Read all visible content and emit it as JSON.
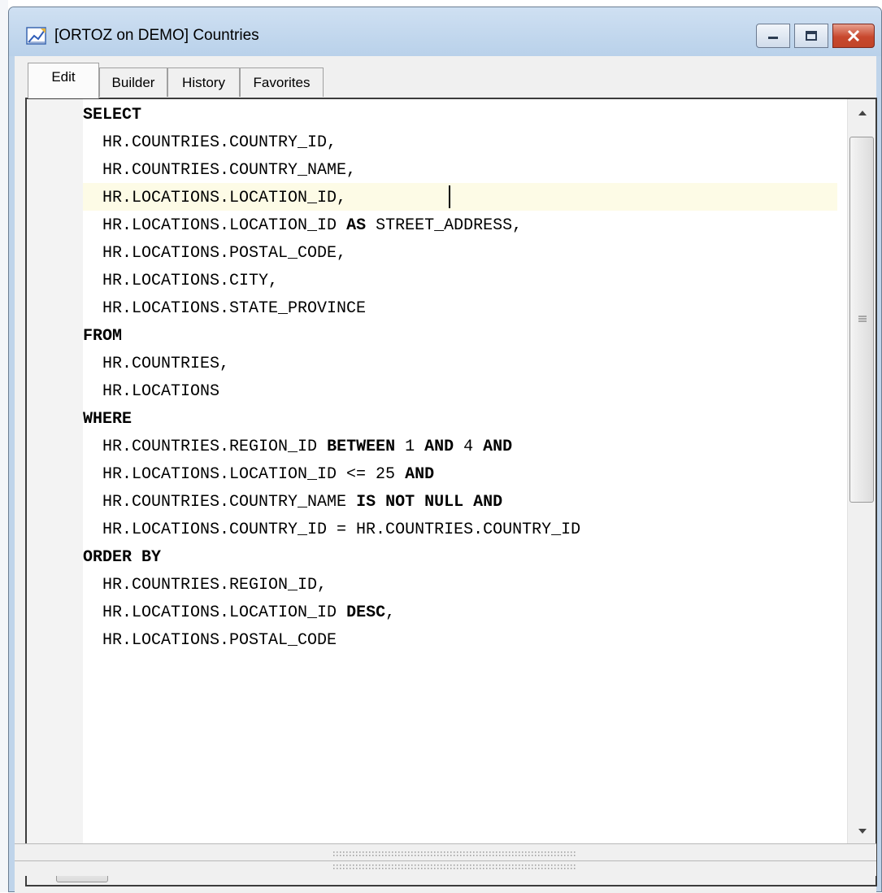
{
  "window": {
    "title": "[ORTOZ on DEMO] Countries",
    "controls": [
      "minimize-icon",
      "maximize-icon",
      "close-icon"
    ]
  },
  "tabs": [
    {
      "label": "Edit",
      "active": true
    },
    {
      "label": "Builder",
      "active": false
    },
    {
      "label": "History",
      "active": false
    },
    {
      "label": "Favorites",
      "active": false
    }
  ],
  "editor": {
    "current_line": 3,
    "lines": [
      "SELECT",
      "  HR.COUNTRIES.COUNTRY_ID,",
      "  HR.COUNTRIES.COUNTRY_NAME,",
      "  HR.LOCATIONS.LOCATION_ID,",
      "  HR.LOCATIONS.LOCATION_ID AS STREET_ADDRESS,",
      "  HR.LOCATIONS.POSTAL_CODE,",
      "  HR.LOCATIONS.CITY,",
      "  HR.LOCATIONS.STATE_PROVINCE",
      "FROM",
      "  HR.COUNTRIES,",
      "  HR.LOCATIONS",
      "WHERE",
      "  HR.COUNTRIES.REGION_ID BETWEEN 1 AND 4 AND",
      "  HR.LOCATIONS.LOCATION_ID <= 25 AND",
      "  HR.COUNTRIES.COUNTRY_NAME IS NOT NULL AND",
      "  HR.LOCATIONS.COUNTRY_ID = HR.COUNTRIES.COUNTRY_ID",
      "ORDER BY",
      "  HR.COUNTRIES.REGION_ID,",
      "  HR.LOCATIONS.LOCATION_ID DESC,",
      "  HR.LOCATIONS.POSTAL_CODE"
    ],
    "keywords": [
      "SELECT",
      "FROM",
      "WHERE",
      "ORDER BY",
      "AS",
      "BETWEEN",
      "AND",
      "IS",
      "NOT",
      "NULL",
      "DESC"
    ]
  },
  "scrollbars": {
    "vertical_position": 0.0,
    "horizontal_position": 0.0
  }
}
